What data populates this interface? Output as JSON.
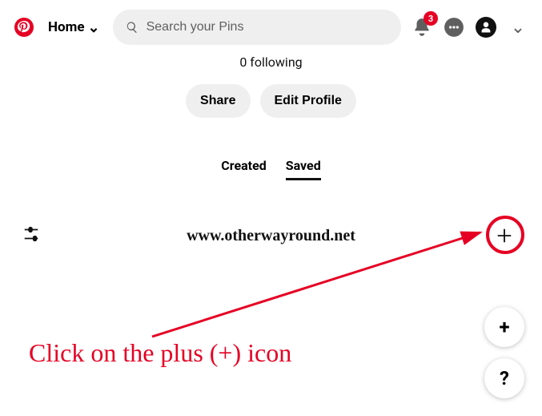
{
  "header": {
    "home_label": "Home",
    "search_placeholder": "Search your Pins",
    "notification_count": "3"
  },
  "profile": {
    "following_text": "0 following",
    "share_label": "Share",
    "edit_label": "Edit Profile"
  },
  "tabs": {
    "created": "Created",
    "saved": "Saved"
  },
  "watermark": "www.otherwayround.net",
  "fab": {
    "plus": "+",
    "help": "?"
  },
  "annotation": {
    "text": "Click on the plus (+) icon"
  }
}
